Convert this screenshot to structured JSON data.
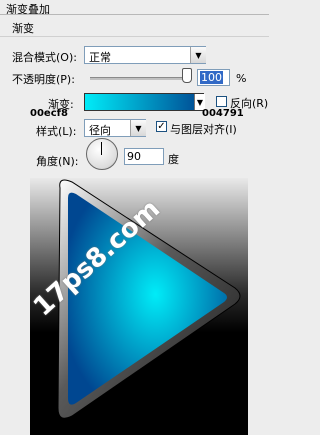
{
  "panel": {
    "title": "渐变叠加",
    "section": "渐变"
  },
  "blend": {
    "label": "混合模式(O):",
    "value": "正常"
  },
  "opacity": {
    "label": "不透明度(P):",
    "value": "100",
    "unit": "%",
    "level": 1.0
  },
  "gradient": {
    "label": "渐变:",
    "start_color": "#00ecf8",
    "end_color": "#004791",
    "start_hex_label": "00ecf8",
    "end_hex_label": "004791",
    "reverse_label": "反向(R)",
    "reverse_checked": false
  },
  "style": {
    "label": "样式(L):",
    "value": "径向",
    "align_label": "与图层对齐(I)",
    "align_checked": true
  },
  "angle": {
    "label": "角度(N):",
    "value": "90",
    "unit": "度"
  },
  "canvas": {
    "watermark": "17ps8.com"
  },
  "icons": {
    "dropdown": "chevron-down-icon",
    "check": "check-icon"
  }
}
